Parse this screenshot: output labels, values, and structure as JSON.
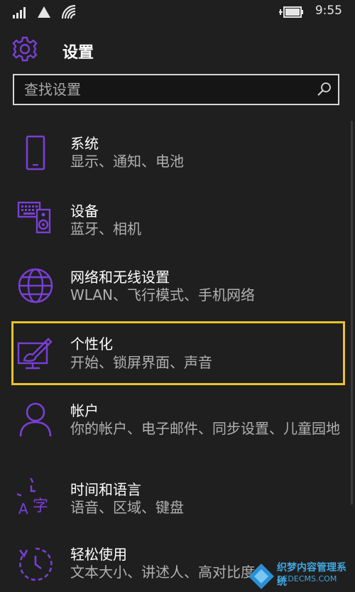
{
  "status_bar": {
    "time": "9:55"
  },
  "header": {
    "title": "设置"
  },
  "search": {
    "placeholder": "查找设置"
  },
  "colors": {
    "accent": "#7a3fd6",
    "selection": "#e8c22c",
    "background": "#1f1f1f",
    "secondary_text": "#b0b0b0"
  },
  "items": [
    {
      "icon": "phone-icon",
      "label": "系统",
      "desc": "显示、通知、电池"
    },
    {
      "icon": "devices-icon",
      "label": "设备",
      "desc": "蓝牙、相机"
    },
    {
      "icon": "globe-icon",
      "label": "网络和无线设置",
      "desc": "WLAN、飞行模式、手机网络"
    },
    {
      "icon": "personalization-icon",
      "label": "个性化",
      "desc": "开始、锁屏界面、声音"
    },
    {
      "icon": "person-icon",
      "label": "帐户",
      "desc": "你的帐户、电子邮件、同步设置、儿童园地"
    },
    {
      "icon": "time-language-icon",
      "label": "时间和语言",
      "desc": "语音、区域、键盘"
    },
    {
      "icon": "ease-of-access-icon",
      "label": "轻松使用",
      "desc": "文本大小、讲述人、高对比度"
    }
  ],
  "watermark": {
    "text": "织梦内容管理系统",
    "url": "DEDECMS.COM"
  }
}
